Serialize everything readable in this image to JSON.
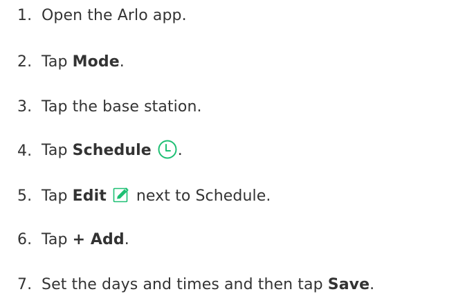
{
  "steps": [
    {
      "num": "1.",
      "text": "Open the Arlo app."
    },
    {
      "num": "2.",
      "pre": "Tap ",
      "bold": "Mode",
      "post": "."
    },
    {
      "num": "3.",
      "text": "Tap the base station."
    },
    {
      "num": "4.",
      "pre": "Tap ",
      "bold": "Schedule",
      "post": ".",
      "icon": "clock-icon"
    },
    {
      "num": "5.",
      "pre": "Tap ",
      "bold": "Edit",
      "post": "next to Schedule.",
      "icon": "edit-icon"
    },
    {
      "num": "6.",
      "pre": "Tap ",
      "bold": "+ Add",
      "post": "."
    },
    {
      "num": "7.",
      "pre": "Set the days and times and then tap ",
      "bold": "Save",
      "post": "."
    }
  ],
  "colors": {
    "text": "#333333",
    "accent": "#1dbf73",
    "background": "#ffffff"
  }
}
